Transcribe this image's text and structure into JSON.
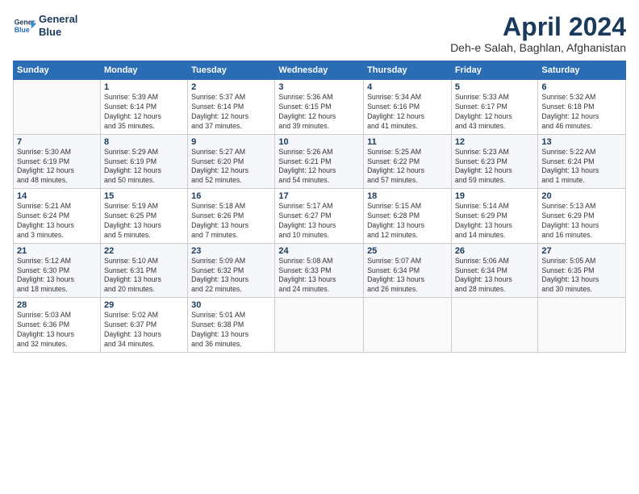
{
  "header": {
    "logo_line1": "General",
    "logo_line2": "Blue",
    "month": "April 2024",
    "location": "Deh-e Salah, Baghlan, Afghanistan"
  },
  "weekdays": [
    "Sunday",
    "Monday",
    "Tuesday",
    "Wednesday",
    "Thursday",
    "Friday",
    "Saturday"
  ],
  "weeks": [
    [
      {
        "day": "",
        "info": ""
      },
      {
        "day": "1",
        "info": "Sunrise: 5:39 AM\nSunset: 6:14 PM\nDaylight: 12 hours\nand 35 minutes."
      },
      {
        "day": "2",
        "info": "Sunrise: 5:37 AM\nSunset: 6:14 PM\nDaylight: 12 hours\nand 37 minutes."
      },
      {
        "day": "3",
        "info": "Sunrise: 5:36 AM\nSunset: 6:15 PM\nDaylight: 12 hours\nand 39 minutes."
      },
      {
        "day": "4",
        "info": "Sunrise: 5:34 AM\nSunset: 6:16 PM\nDaylight: 12 hours\nand 41 minutes."
      },
      {
        "day": "5",
        "info": "Sunrise: 5:33 AM\nSunset: 6:17 PM\nDaylight: 12 hours\nand 43 minutes."
      },
      {
        "day": "6",
        "info": "Sunrise: 5:32 AM\nSunset: 6:18 PM\nDaylight: 12 hours\nand 46 minutes."
      }
    ],
    [
      {
        "day": "7",
        "info": "Sunrise: 5:30 AM\nSunset: 6:19 PM\nDaylight: 12 hours\nand 48 minutes."
      },
      {
        "day": "8",
        "info": "Sunrise: 5:29 AM\nSunset: 6:19 PM\nDaylight: 12 hours\nand 50 minutes."
      },
      {
        "day": "9",
        "info": "Sunrise: 5:27 AM\nSunset: 6:20 PM\nDaylight: 12 hours\nand 52 minutes."
      },
      {
        "day": "10",
        "info": "Sunrise: 5:26 AM\nSunset: 6:21 PM\nDaylight: 12 hours\nand 54 minutes."
      },
      {
        "day": "11",
        "info": "Sunrise: 5:25 AM\nSunset: 6:22 PM\nDaylight: 12 hours\nand 57 minutes."
      },
      {
        "day": "12",
        "info": "Sunrise: 5:23 AM\nSunset: 6:23 PM\nDaylight: 12 hours\nand 59 minutes."
      },
      {
        "day": "13",
        "info": "Sunrise: 5:22 AM\nSunset: 6:24 PM\nDaylight: 13 hours\nand 1 minute."
      }
    ],
    [
      {
        "day": "14",
        "info": "Sunrise: 5:21 AM\nSunset: 6:24 PM\nDaylight: 13 hours\nand 3 minutes."
      },
      {
        "day": "15",
        "info": "Sunrise: 5:19 AM\nSunset: 6:25 PM\nDaylight: 13 hours\nand 5 minutes."
      },
      {
        "day": "16",
        "info": "Sunrise: 5:18 AM\nSunset: 6:26 PM\nDaylight: 13 hours\nand 7 minutes."
      },
      {
        "day": "17",
        "info": "Sunrise: 5:17 AM\nSunset: 6:27 PM\nDaylight: 13 hours\nand 10 minutes."
      },
      {
        "day": "18",
        "info": "Sunrise: 5:15 AM\nSunset: 6:28 PM\nDaylight: 13 hours\nand 12 minutes."
      },
      {
        "day": "19",
        "info": "Sunrise: 5:14 AM\nSunset: 6:29 PM\nDaylight: 13 hours\nand 14 minutes."
      },
      {
        "day": "20",
        "info": "Sunrise: 5:13 AM\nSunset: 6:29 PM\nDaylight: 13 hours\nand 16 minutes."
      }
    ],
    [
      {
        "day": "21",
        "info": "Sunrise: 5:12 AM\nSunset: 6:30 PM\nDaylight: 13 hours\nand 18 minutes."
      },
      {
        "day": "22",
        "info": "Sunrise: 5:10 AM\nSunset: 6:31 PM\nDaylight: 13 hours\nand 20 minutes."
      },
      {
        "day": "23",
        "info": "Sunrise: 5:09 AM\nSunset: 6:32 PM\nDaylight: 13 hours\nand 22 minutes."
      },
      {
        "day": "24",
        "info": "Sunrise: 5:08 AM\nSunset: 6:33 PM\nDaylight: 13 hours\nand 24 minutes."
      },
      {
        "day": "25",
        "info": "Sunrise: 5:07 AM\nSunset: 6:34 PM\nDaylight: 13 hours\nand 26 minutes."
      },
      {
        "day": "26",
        "info": "Sunrise: 5:06 AM\nSunset: 6:34 PM\nDaylight: 13 hours\nand 28 minutes."
      },
      {
        "day": "27",
        "info": "Sunrise: 5:05 AM\nSunset: 6:35 PM\nDaylight: 13 hours\nand 30 minutes."
      }
    ],
    [
      {
        "day": "28",
        "info": "Sunrise: 5:03 AM\nSunset: 6:36 PM\nDaylight: 13 hours\nand 32 minutes."
      },
      {
        "day": "29",
        "info": "Sunrise: 5:02 AM\nSunset: 6:37 PM\nDaylight: 13 hours\nand 34 minutes."
      },
      {
        "day": "30",
        "info": "Sunrise: 5:01 AM\nSunset: 6:38 PM\nDaylight: 13 hours\nand 36 minutes."
      },
      {
        "day": "",
        "info": ""
      },
      {
        "day": "",
        "info": ""
      },
      {
        "day": "",
        "info": ""
      },
      {
        "day": "",
        "info": ""
      }
    ]
  ]
}
